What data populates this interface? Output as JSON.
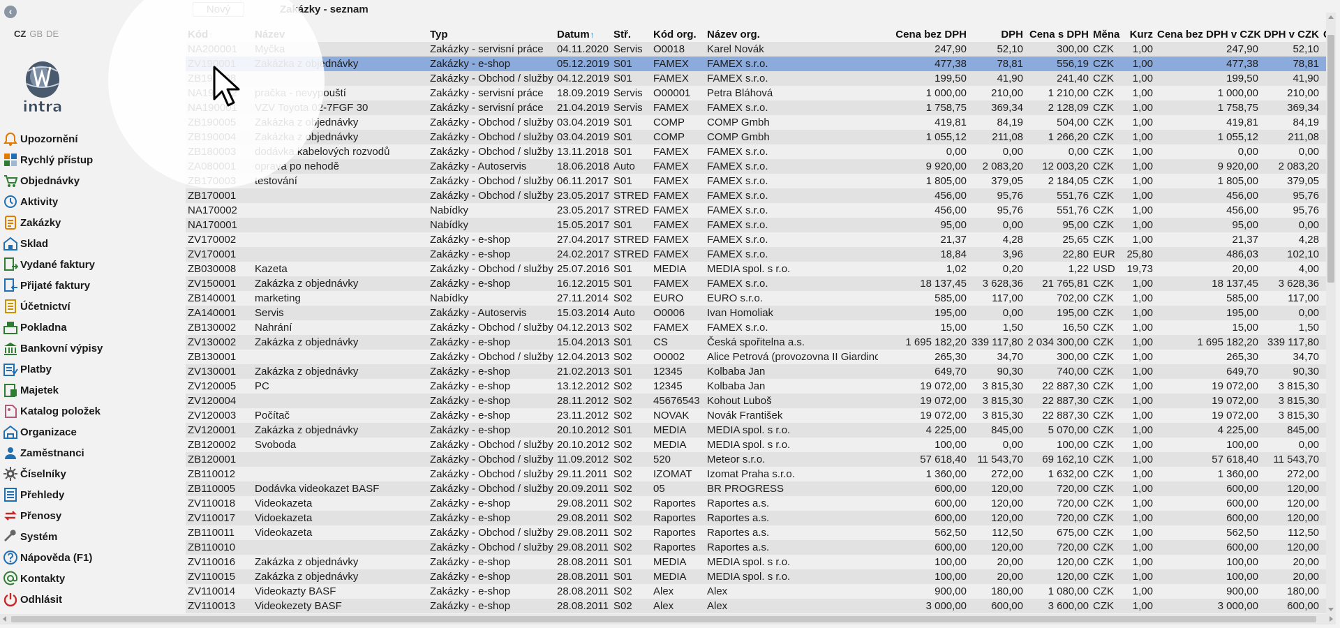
{
  "header": {
    "new_button": "Nový",
    "title": "Zakázky - seznam"
  },
  "languages": [
    {
      "code": "CZ",
      "active": true
    },
    {
      "code": "GB",
      "active": false
    },
    {
      "code": "DE",
      "active": false
    }
  ],
  "logo": {
    "text": "intra"
  },
  "menu": [
    {
      "label": "Upozornění",
      "icon": "bell-icon",
      "color": "#e07b00"
    },
    {
      "label": "Rychlý přístup",
      "icon": "quick-access-icon",
      "color": "#2e7d32"
    },
    {
      "label": "Objednávky",
      "icon": "cart-icon",
      "color": "#2e7d32"
    },
    {
      "label": "Aktivity",
      "icon": "clock-icon",
      "color": "#1f6fb2"
    },
    {
      "label": "Zakázky",
      "icon": "order-icon",
      "color": "#e07b00"
    },
    {
      "label": "Sklad",
      "icon": "warehouse-icon",
      "color": "#1f6fb2"
    },
    {
      "label": "Vydané faktury",
      "icon": "invoice-out-icon",
      "color": "#2e7d32"
    },
    {
      "label": "Přijaté faktury",
      "icon": "invoice-in-icon",
      "color": "#1f6fb2"
    },
    {
      "label": "Účetnictví",
      "icon": "ledger-icon",
      "color": "#c99400"
    },
    {
      "label": "Pokladna",
      "icon": "cash-register-icon",
      "color": "#2e7d32"
    },
    {
      "label": "Bankovní výpisy",
      "icon": "bank-icon",
      "color": "#2e7d32"
    },
    {
      "label": "Platby",
      "icon": "payments-icon",
      "color": "#1f6fb2"
    },
    {
      "label": "Majetek",
      "icon": "assets-icon",
      "color": "#2e7d32"
    },
    {
      "label": "Katalog položek",
      "icon": "catalog-icon",
      "color": "#b05a7a"
    },
    {
      "label": "Organizace",
      "icon": "organization-icon",
      "color": "#1f6fb2"
    },
    {
      "label": "Zaměstnanci",
      "icon": "employees-icon",
      "color": "#1f6fb2"
    },
    {
      "label": "Číselníky",
      "icon": "gear-icon",
      "color": "#555555"
    },
    {
      "label": "Přehledy",
      "icon": "reports-icon",
      "color": "#1f6fb2"
    },
    {
      "label": "Přenosy",
      "icon": "transfer-icon",
      "color": "#c62828"
    },
    {
      "label": "Systém",
      "icon": "wrench-icon",
      "color": "#666666"
    },
    {
      "label": "Nápověda (F1)",
      "icon": "help-icon",
      "color": "#1f6fb2"
    },
    {
      "label": "Kontakty",
      "icon": "at-icon",
      "color": "#2e7d32"
    },
    {
      "label": "Odhlásit",
      "icon": "power-icon",
      "color": "#c62828"
    }
  ],
  "table": {
    "columns": [
      {
        "label": "Kód",
        "sort": "asc"
      },
      {
        "label": "Název"
      },
      {
        "label": "Typ"
      },
      {
        "label": "Datum",
        "sort": "asc"
      },
      {
        "label": "Stř."
      },
      {
        "label": "Kód org."
      },
      {
        "label": "Název org."
      },
      {
        "label": "Cena bez DPH"
      },
      {
        "label": "DPH"
      },
      {
        "label": "Cena s DPH"
      },
      {
        "label": "Měna"
      },
      {
        "label": "Kurz"
      },
      {
        "label": "Cena bez DPH v CZK"
      },
      {
        "label": "DPH v CZK"
      },
      {
        "label": "Cen"
      }
    ],
    "selected_row": 1,
    "rows": [
      [
        "NA200001",
        "Myčka",
        "Zakázky - servisní práce",
        "04.11.2020",
        "Servis",
        "O0018",
        "Karel Novák",
        "247,90",
        "52,10",
        "300,00",
        "CZK",
        "1,00",
        "247,90",
        "52,10",
        ""
      ],
      [
        "ZV190001",
        "Zakázka z objednávky",
        "Zakázky - e-shop",
        "05.12.2019",
        "S01",
        "FAMEX",
        "FAMEX s.r.o.",
        "477,38",
        "78,81",
        "556,19",
        "CZK",
        "1,00",
        "477,38",
        "78,81",
        ""
      ],
      [
        "ZB190008",
        "",
        "Zakázky - Obchod / služby",
        "04.12.2019",
        "S01",
        "FAMEX",
        "FAMEX s.r.o.",
        "199,50",
        "41,90",
        "241,40",
        "CZK",
        "1,00",
        "199,50",
        "41,90",
        ""
      ],
      [
        "NA190002",
        "pračka - nevypouští",
        "Zakázky - servisní práce",
        "18.09.2019",
        "Servis",
        "O00001",
        "Petra Bláhová",
        "1 000,00",
        "210,00",
        "1 210,00",
        "CZK",
        "1,00",
        "1 000,00",
        "210,00",
        ""
      ],
      [
        "NA190001",
        "VZV Toyota 02-7FGF 30",
        "Zakázky - servisní práce",
        "21.04.2019",
        "Servis",
        "FAMEX",
        "FAMEX s.r.o.",
        "1 758,75",
        "369,34",
        "2 128,09",
        "CZK",
        "1,00",
        "1 758,75",
        "369,34",
        ""
      ],
      [
        "ZB190005",
        "Zakázka z objednávky",
        "Zakázky - Obchod / služby",
        "03.04.2019",
        "S01",
        "COMP",
        "COMP Gmbh",
        "419,81",
        "84,19",
        "504,00",
        "CZK",
        "1,00",
        "419,81",
        "84,19",
        ""
      ],
      [
        "ZB190004",
        "Zakázka z objednávky",
        "Zakázky - Obchod / služby",
        "03.04.2019",
        "S01",
        "COMP",
        "COMP Gmbh",
        "1 055,12",
        "211,08",
        "1 266,20",
        "CZK",
        "1,00",
        "1 055,12",
        "211,08",
        ""
      ],
      [
        "ZB180003",
        "dodávka kabelových rozvodů",
        "Zakázky - Obchod / služby",
        "13.11.2018",
        "S01",
        "FAMEX",
        "FAMEX s.r.o.",
        "0,00",
        "0,00",
        "0,00",
        "CZK",
        "1,00",
        "0,00",
        "0,00",
        ""
      ],
      [
        "ZA080001",
        "oprava po nehodě",
        "Zakázky - Autoservis",
        "18.06.2018",
        "Auto",
        "FAMEX",
        "FAMEX s.r.o.",
        "9 920,00",
        "2 083,20",
        "12 003,20",
        "CZK",
        "1,00",
        "9 920,00",
        "2 083,20",
        ""
      ],
      [
        "ZB170003",
        "testování",
        "Zakázky - Obchod / služby",
        "06.11.2017",
        "S01",
        "FAMEX",
        "FAMEX s.r.o.",
        "1 805,00",
        "379,05",
        "2 184,05",
        "CZK",
        "1,00",
        "1 805,00",
        "379,05",
        ""
      ],
      [
        "ZB170001",
        "",
        "Zakázky - Obchod / služby",
        "23.05.2017",
        "STRED",
        "FAMEX",
        "FAMEX s.r.o.",
        "456,00",
        "95,76",
        "551,76",
        "CZK",
        "1,00",
        "456,00",
        "95,76",
        ""
      ],
      [
        "NA170002",
        "",
        "Nabídky",
        "23.05.2017",
        "STRED",
        "FAMEX",
        "FAMEX s.r.o.",
        "456,00",
        "95,76",
        "551,76",
        "CZK",
        "1,00",
        "456,00",
        "95,76",
        ""
      ],
      [
        "NA170001",
        "",
        "Nabídky",
        "15.05.2017",
        "S01",
        "FAMEX",
        "FAMEX s.r.o.",
        "95,00",
        "0,00",
        "95,00",
        "CZK",
        "1,00",
        "95,00",
        "0,00",
        ""
      ],
      [
        "ZV170002",
        "",
        "Zakázky - e-shop",
        "27.04.2017",
        "STRED",
        "FAMEX",
        "FAMEX s.r.o.",
        "21,37",
        "4,28",
        "25,65",
        "CZK",
        "1,00",
        "21,37",
        "4,28",
        ""
      ],
      [
        "ZV170001",
        "",
        "Zakázky - e-shop",
        "24.02.2017",
        "STRED",
        "FAMEX",
        "FAMEX s.r.o.",
        "18,84",
        "3,96",
        "22,80",
        "EUR",
        "25,80",
        "486,03",
        "102,10",
        ""
      ],
      [
        "ZB030008",
        "Kazeta",
        "Zakázky - Obchod / služby",
        "25.07.2016",
        "S01",
        "MEDIA",
        "MEDIA spol. s r.o.",
        "1,02",
        "0,20",
        "1,22",
        "USD",
        "19,73",
        "20,00",
        "4,00",
        ""
      ],
      [
        "ZV150001",
        "Zakázka z objednávky",
        "Zakázky - e-shop",
        "16.12.2015",
        "S01",
        "FAMEX",
        "FAMEX s.r.o.",
        "18 137,45",
        "3 628,36",
        "21 765,81",
        "CZK",
        "1,00",
        "18 137,45",
        "3 628,36",
        ""
      ],
      [
        "ZB140001",
        "marketing",
        "Nabídky",
        "27.11.2014",
        "S02",
        "EURO",
        "EURO s.r.o.",
        "585,00",
        "117,00",
        "702,00",
        "CZK",
        "1,00",
        "585,00",
        "117,00",
        ""
      ],
      [
        "ZA140001",
        "Servis",
        "Zakázky - Autoservis",
        "15.03.2014",
        "Auto",
        "O0006",
        "Ivan Homoliak",
        "195,00",
        "0,00",
        "195,00",
        "CZK",
        "1,00",
        "195,00",
        "0,00",
        ""
      ],
      [
        "ZB130002",
        "Nahrání",
        "Zakázky - Obchod / služby",
        "04.12.2013",
        "S02",
        "FAMEX",
        "FAMEX s.r.o.",
        "15,00",
        "1,50",
        "16,50",
        "CZK",
        "1,00",
        "15,00",
        "1,50",
        ""
      ],
      [
        "ZV130002",
        "Zakázka z objednávky",
        "Zakázky - e-shop",
        "15.04.2013",
        "S01",
        "CS",
        "Česká spořitelna a.s.",
        "1 695 182,20",
        "339 117,80",
        "2 034 300,00",
        "CZK",
        "1,00",
        "1 695 182,20",
        "339 117,80",
        ""
      ],
      [
        "ZB130001",
        "",
        "Zakázky - Obchod / služby",
        "12.04.2013",
        "S02",
        "O0002",
        "Alice Petrová (provozovna II Giardino)",
        "265,30",
        "34,70",
        "300,00",
        "CZK",
        "1,00",
        "265,30",
        "34,70",
        ""
      ],
      [
        "ZV130001",
        "Zakázka z objednávky",
        "Zakázky - e-shop",
        "21.02.2013",
        "S01",
        "12345",
        "Kolbaba Jan",
        "649,70",
        "90,30",
        "740,00",
        "CZK",
        "1,00",
        "649,70",
        "90,30",
        ""
      ],
      [
        "ZV120005",
        "PC",
        "Zakázky - e-shop",
        "13.12.2012",
        "S02",
        "12345",
        "Kolbaba Jan",
        "19 072,00",
        "3 815,30",
        "22 887,30",
        "CZK",
        "1,00",
        "19 072,00",
        "3 815,30",
        ""
      ],
      [
        "ZV120004",
        "",
        "Zakázky - e-shop",
        "28.11.2012",
        "S02",
        "45676543",
        "Kohout Luboš",
        "19 072,00",
        "3 815,30",
        "22 887,30",
        "CZK",
        "1,00",
        "19 072,00",
        "3 815,30",
        ""
      ],
      [
        "ZV120003",
        "Počítač",
        "Zakázky - e-shop",
        "23.11.2012",
        "S02",
        "NOVAK",
        "Novák František",
        "19 072,00",
        "3 815,30",
        "22 887,30",
        "CZK",
        "1,00",
        "19 072,00",
        "3 815,30",
        ""
      ],
      [
        "ZV120001",
        "Zakázka z objednávky",
        "Zakázky - e-shop",
        "20.10.2012",
        "S01",
        "MEDIA",
        "MEDIA spol. s r.o.",
        "4 225,00",
        "845,00",
        "5 070,00",
        "CZK",
        "1,00",
        "4 225,00",
        "845,00",
        ""
      ],
      [
        "ZB120002",
        "Svoboda",
        "Zakázky - Obchod / služby",
        "20.10.2012",
        "S02",
        "MEDIA",
        "MEDIA spol. s r.o.",
        "100,00",
        "0,00",
        "100,00",
        "CZK",
        "1,00",
        "100,00",
        "0,00",
        ""
      ],
      [
        "ZB120001",
        "",
        "Zakázky - Obchod / služby",
        "11.09.2012",
        "S02",
        "520",
        "Meteor s.r.o.",
        "57 618,40",
        "11 543,70",
        "69 162,10",
        "CZK",
        "1,00",
        "57 618,40",
        "11 543,70",
        ""
      ],
      [
        "ZB110012",
        "",
        "Zakázky - Obchod / služby",
        "29.11.2011",
        "S02",
        "IZOMAT",
        "Izomat Praha s.r.o.",
        "1 360,00",
        "272,00",
        "1 632,00",
        "CZK",
        "1,00",
        "1 360,00",
        "272,00",
        ""
      ],
      [
        "ZB110005",
        "Dodávka videokazet BASF",
        "Zakázky - Obchod / služby",
        "20.09.2011",
        "S02",
        "05",
        "BR PROGRESS",
        "600,00",
        "120,00",
        "720,00",
        "CZK",
        "1,00",
        "600,00",
        "120,00",
        ""
      ],
      [
        "ZV110018",
        "Videokazeta",
        "Zakázky - e-shop",
        "29.08.2011",
        "S02",
        "Raportes",
        "Raportes a.s.",
        "600,00",
        "120,00",
        "720,00",
        "CZK",
        "1,00",
        "600,00",
        "120,00",
        ""
      ],
      [
        "ZV110017",
        "Vidoekazeta",
        "Zakázky - e-shop",
        "29.08.2011",
        "S02",
        "Raportes",
        "Raportes a.s.",
        "600,00",
        "120,00",
        "720,00",
        "CZK",
        "1,00",
        "600,00",
        "120,00",
        ""
      ],
      [
        "ZB110011",
        "Videokazeta",
        "Zakázky - Obchod / služby",
        "29.08.2011",
        "S02",
        "Raportes",
        "Raportes a.s.",
        "562,50",
        "112,50",
        "675,00",
        "CZK",
        "1,00",
        "562,50",
        "112,50",
        ""
      ],
      [
        "ZB110010",
        "",
        "Zakázky - Obchod / služby",
        "29.08.2011",
        "S02",
        "Raportes",
        "Raportes a.s.",
        "600,00",
        "120,00",
        "720,00",
        "CZK",
        "1,00",
        "600,00",
        "120,00",
        ""
      ],
      [
        "ZV110016",
        "Zakázka z objednávky",
        "Zakázky - e-shop",
        "28.08.2011",
        "S01",
        "MEDIA",
        "MEDIA spol. s r.o.",
        "100,00",
        "20,00",
        "120,00",
        "CZK",
        "1,00",
        "100,00",
        "20,00",
        ""
      ],
      [
        "ZV110015",
        "Zakázka z objednávky",
        "Zakázky - e-shop",
        "28.08.2011",
        "S01",
        "MEDIA",
        "MEDIA spol. s r.o.",
        "100,00",
        "20,00",
        "120,00",
        "CZK",
        "1,00",
        "100,00",
        "20,00",
        ""
      ],
      [
        "ZV110014",
        "Videokazty BASF",
        "Zakázky - e-shop",
        "28.08.2011",
        "S02",
        "Alex",
        "Alex",
        "900,00",
        "180,00",
        "1 080,00",
        "CZK",
        "1,00",
        "900,00",
        "180,00",
        ""
      ],
      [
        "ZV110013",
        "Videokezety BASF",
        "Zakázky - e-shop",
        "28.08.2011",
        "S02",
        "Alex",
        "Alex",
        "3 000,00",
        "600,00",
        "3 600,00",
        "CZK",
        "1,00",
        "3 000,00",
        "600,00",
        ""
      ]
    ]
  }
}
